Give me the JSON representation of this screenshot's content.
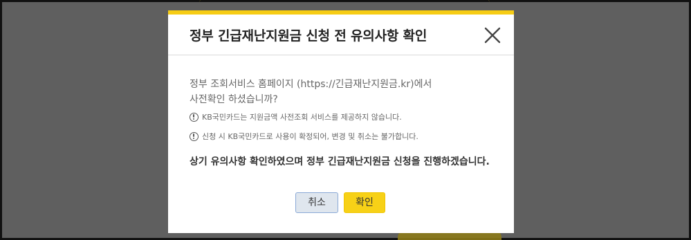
{
  "modal": {
    "title": "정부 긴급재난지원금 신청 전 유의사항 확인",
    "intro_line1": "정부 조회서비스 홈페이지 (https://긴급재난지원금.kr)에서",
    "intro_line2": "사전확인 하셨습니까?",
    "notices": [
      {
        "icon": "exclamation-circle-icon",
        "text": "KB국민카드는 지원금액 사전조회 서비스를 제공하지 않습니다."
      },
      {
        "icon": "exclamation-circle-icon",
        "text": "신청 시 KB국민카드로 사용이 확정되어, 변경 및 취소는 불가합니다."
      }
    ],
    "confirm_text": "상기 유의사항 확인하였으며 정부 긴급재난지원금 신청을 진행하겠습니다.",
    "buttons": {
      "cancel_label": "취소",
      "ok_label": "확인"
    },
    "close_icon": "close-icon"
  },
  "colors": {
    "accent_yellow": "#f6cc14",
    "overlay": "#5f5f5f",
    "cancel_bg": "#dfe6ee",
    "cancel_border": "#8aa9d6"
  }
}
